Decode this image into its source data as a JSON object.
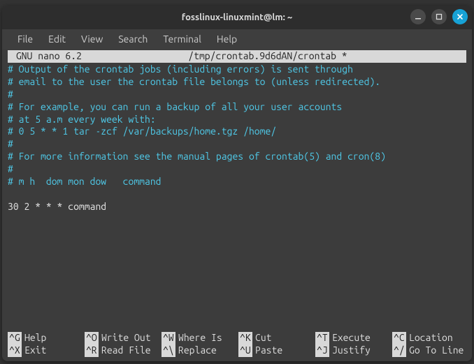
{
  "window": {
    "title": "fosslinux-linuxmint@lm: ~"
  },
  "menubar": {
    "items": [
      "File",
      "Edit",
      "View",
      "Search",
      "Terminal",
      "Help"
    ]
  },
  "nano": {
    "version": " GNU nano 6.2",
    "filepath": "/tmp/crontab.9d6dAN/crontab *",
    "modified_mark": " "
  },
  "editor": {
    "lines": [
      {
        "cls": "comment",
        "text": "# Output of the crontab jobs (including errors) is sent through"
      },
      {
        "cls": "comment",
        "text": "# email to the user the crontab file belongs to (unless redirected)."
      },
      {
        "cls": "comment",
        "text": "#"
      },
      {
        "cls": "comment",
        "text": "# For example, you can run a backup of all your user accounts"
      },
      {
        "cls": "comment",
        "text": "# at 5 a.m every week with:"
      },
      {
        "cls": "comment",
        "text": "# 0 5 * * 1 tar -zcf /var/backups/home.tgz /home/"
      },
      {
        "cls": "comment",
        "text": "#"
      },
      {
        "cls": "comment",
        "text": "# For more information see the manual pages of crontab(5) and cron(8)"
      },
      {
        "cls": "comment",
        "text": "#"
      },
      {
        "cls": "comment",
        "text": "# m h  dom mon dow   command"
      },
      {
        "cls": "plain",
        "text": ""
      },
      {
        "cls": "plain",
        "text": "30 2 * * * command"
      }
    ]
  },
  "shortcuts": [
    {
      "key": "^G",
      "label": "Help"
    },
    {
      "key": "^O",
      "label": "Write Out"
    },
    {
      "key": "^W",
      "label": "Where Is"
    },
    {
      "key": "^K",
      "label": "Cut"
    },
    {
      "key": "^T",
      "label": "Execute"
    },
    {
      "key": "^C",
      "label": "Location"
    },
    {
      "key": "^X",
      "label": "Exit"
    },
    {
      "key": "^R",
      "label": "Read File"
    },
    {
      "key": "^\\",
      "label": "Replace"
    },
    {
      "key": "^U",
      "label": "Paste"
    },
    {
      "key": "^J",
      "label": "Justify"
    },
    {
      "key": "^/",
      "label": "Go To Line"
    }
  ]
}
